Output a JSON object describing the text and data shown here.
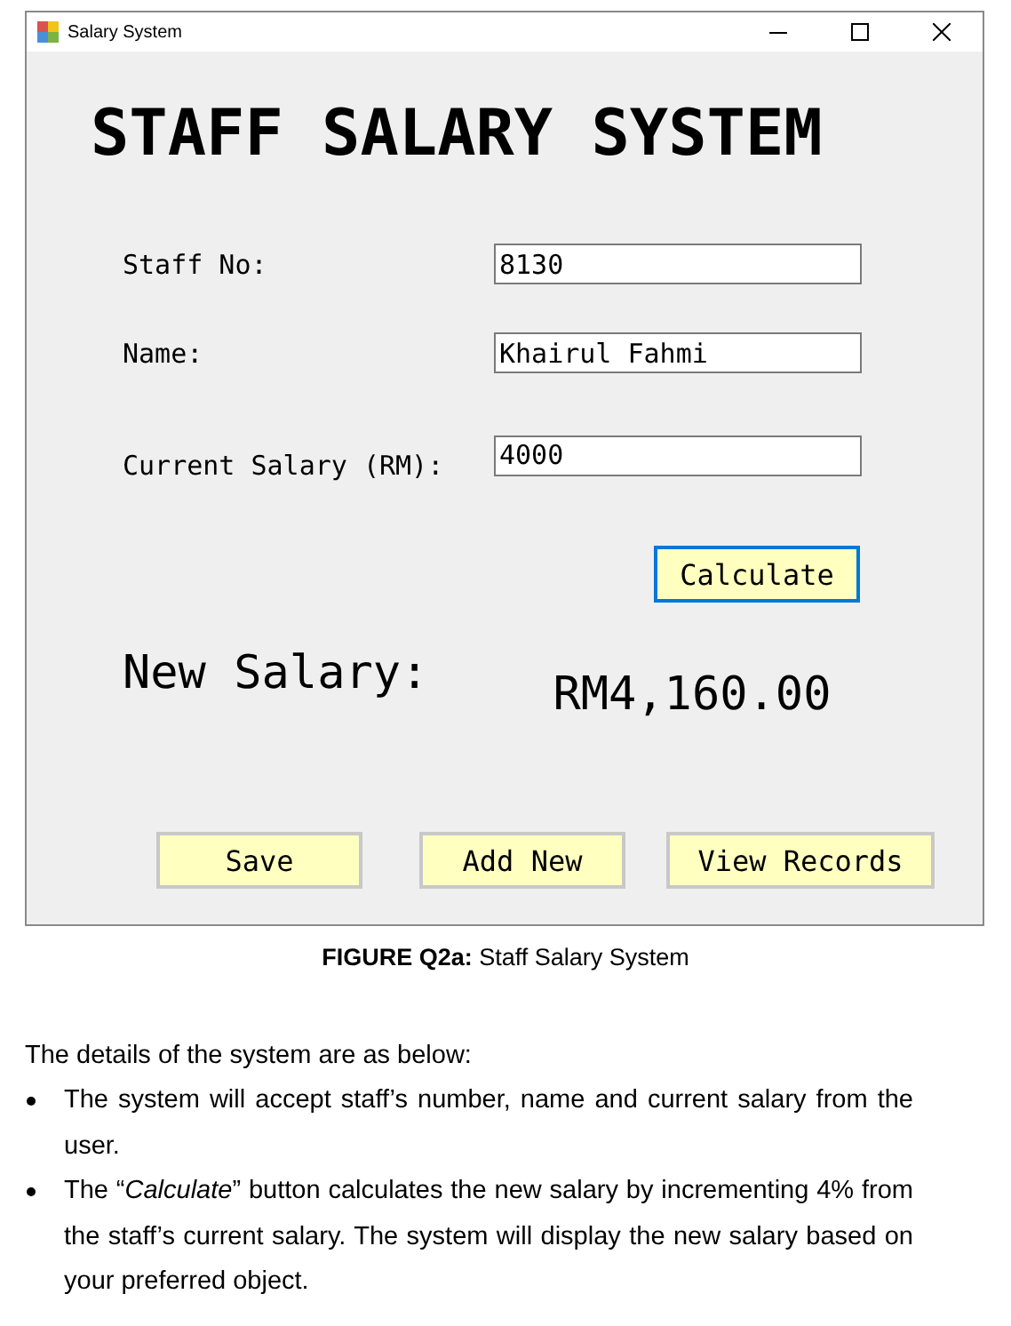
{
  "window": {
    "title": "Salary System"
  },
  "heading": "STAFF SALARY SYSTEM",
  "fields": [
    {
      "label": "Staff No:",
      "value": "8130"
    },
    {
      "label": "Name:",
      "value": "Khairul Fahmi"
    },
    {
      "label": "Current Salary (RM):",
      "value": "4000"
    }
  ],
  "calculate_button": {
    "label": "Calculate",
    "focused": true
  },
  "result": {
    "label": "New Salary:",
    "value": "RM4,160.00"
  },
  "buttons": [
    "Save",
    "Add New",
    "View Records"
  ],
  "caption": {
    "number": "FIGURE Q2a:",
    "text": "Staff Salary System"
  },
  "intro": "The details of the system are as below:",
  "bullets": [
    "The system will accept staff’s number, name and current salary from the user.",
    "The “*Calculate*” button calculates the new salary by incrementing 4% from the staff’s current salary. The system will display the new salary based on your preferred object."
  ]
}
